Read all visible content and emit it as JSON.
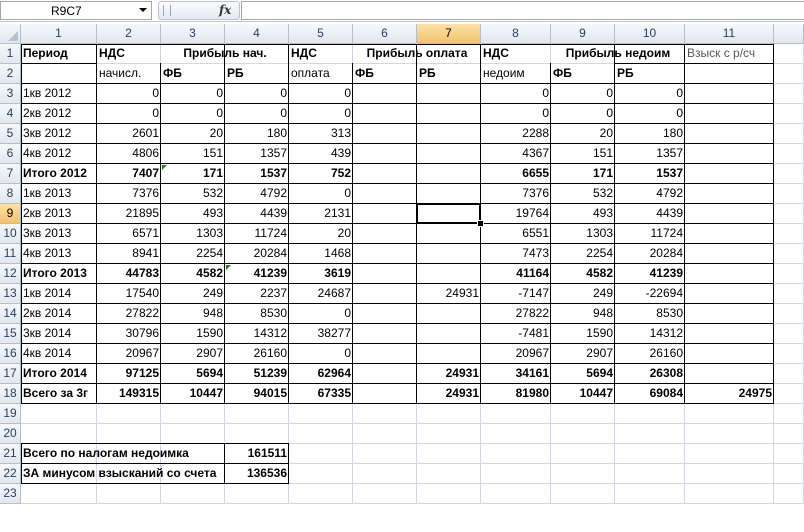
{
  "formula_bar": {
    "name_box": "R9C7",
    "fx_label": "fx",
    "formula": ""
  },
  "columns": [
    "1",
    "2",
    "3",
    "4",
    "5",
    "6",
    "7",
    "8",
    "9",
    "10",
    "11",
    ""
  ],
  "rows": [
    "1",
    "2",
    "3",
    "4",
    "5",
    "6",
    "7",
    "8",
    "9",
    "10",
    "11",
    "12",
    "13",
    "14",
    "15",
    "16",
    "17",
    "18",
    "19",
    "20",
    "21",
    "22",
    "23"
  ],
  "selected": {
    "row": "9",
    "col": "7"
  },
  "header": {
    "period": "Период",
    "nds1": "НДС",
    "nds1_sub": "начисл.",
    "profit_acc": "Прибыль нач.",
    "fb": "ФБ",
    "rb": "РБ",
    "nds2": "НДС",
    "nds2_sub": "оплата",
    "profit_pay": "Прибыль оплата",
    "nds3": "НДС",
    "nds3_sub": "недоим",
    "profit_arr": "Прибыль  недоим",
    "recovery": "Взыск с р/сч"
  },
  "table": [
    {
      "p": "1кв 2012",
      "v": [
        "0",
        "0",
        "0",
        "0",
        "",
        "",
        "0",
        "0",
        "0",
        ""
      ],
      "b": false
    },
    {
      "p": "2кв 2012",
      "v": [
        "0",
        "0",
        "0",
        "0",
        "",
        "",
        "0",
        "0",
        "0",
        ""
      ],
      "b": false
    },
    {
      "p": "3кв 2012",
      "v": [
        "2601",
        "20",
        "180",
        "313",
        "",
        "",
        "2288",
        "20",
        "180",
        ""
      ],
      "b": false
    },
    {
      "p": "4кв 2012",
      "v": [
        "4806",
        "151",
        "1357",
        "439",
        "",
        "",
        "4367",
        "151",
        "1357",
        ""
      ],
      "b": false
    },
    {
      "p": "Итого 2012",
      "v": [
        "7407",
        "171",
        "1537",
        "752",
        "",
        "",
        "6655",
        "171",
        "1537",
        ""
      ],
      "b": true
    },
    {
      "p": "1кв 2013",
      "v": [
        "7376",
        "532",
        "4792",
        "0",
        "",
        "",
        "7376",
        "532",
        "4792",
        ""
      ],
      "b": false
    },
    {
      "p": "2кв 2013",
      "v": [
        "21895",
        "493",
        "4439",
        "2131",
        "",
        "",
        "19764",
        "493",
        "4439",
        ""
      ],
      "b": false
    },
    {
      "p": "3кв 2013",
      "v": [
        "6571",
        "1303",
        "11724",
        "20",
        "",
        "",
        "6551",
        "1303",
        "11724",
        ""
      ],
      "b": false
    },
    {
      "p": "4кв 2013",
      "v": [
        "8941",
        "2254",
        "20284",
        "1468",
        "",
        "",
        "7473",
        "2254",
        "20284",
        ""
      ],
      "b": false
    },
    {
      "p": "Итого 2013",
      "v": [
        "44783",
        "4582",
        "41239",
        "3619",
        "",
        "",
        "41164",
        "4582",
        "41239",
        ""
      ],
      "b": true
    },
    {
      "p": "1кв 2014",
      "v": [
        "17540",
        "249",
        "2237",
        "24687",
        "",
        "24931",
        "-7147",
        "249",
        "-22694",
        ""
      ],
      "b": false
    },
    {
      "p": "2кв 2014",
      "v": [
        "27822",
        "948",
        "8530",
        "0",
        "",
        "",
        "27822",
        "948",
        "8530",
        ""
      ],
      "b": false
    },
    {
      "p": "3кв 2014",
      "v": [
        "30796",
        "1590",
        "14312",
        "38277",
        "",
        "",
        "-7481",
        "1590",
        "14312",
        ""
      ],
      "b": false
    },
    {
      "p": "4кв 2014",
      "v": [
        "20967",
        "2907",
        "26160",
        "0",
        "",
        "",
        "20967",
        "2907",
        "26160",
        ""
      ],
      "b": false
    },
    {
      "p": "Итого 2014",
      "v": [
        "97125",
        "5694",
        "51239",
        "62964",
        "",
        "24931",
        "34161",
        "5694",
        "26308",
        ""
      ],
      "b": true
    },
    {
      "p": "Всего за 3г",
      "v": [
        "149315",
        "10447",
        "94015",
        "67335",
        "",
        "24931",
        "81980",
        "10447",
        "69084",
        "24975"
      ],
      "b": true
    }
  ],
  "summary": {
    "arrears_label": "Всего  по налогам недоимка",
    "arrears_value": "161511",
    "minus_label": "ЗА минусом взысканий со счета",
    "minus_value": "136536"
  }
}
